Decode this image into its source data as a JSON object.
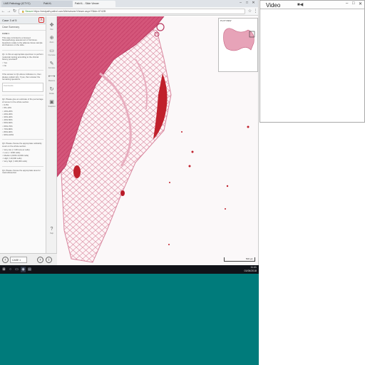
{
  "browser": {
    "tabs": [
      {
        "label": "LMS Pathology (ICTYC)"
      },
      {
        "label": "PathXL"
      },
      {
        "label": "PathXL - Slide Viewer"
      }
    ],
    "window_controls": {
      "minimize": "–",
      "maximize": "□",
      "close": "✕"
    },
    "address": {
      "secure_label": "Secure",
      "url": "https://restpath.pathxl.com/Webviewer/Viewer.aspx?Slide=5742B"
    }
  },
  "question_panel": {
    "title": "Case 3 of 5",
    "close_label": "X",
    "subtitle": "Case Summary",
    "case_label": "CASE 1",
    "intro": "This case is limited to a focused histopathology assessment of fat tissue. Questions relate to the adipose tissue sample and features on the slide.",
    "q1": "Q1. Is this an appropriate specimen to perform molecular testing according to the clinical history provided?",
    "q1_options": [
      "Yes",
      "No"
    ],
    "note": "If the answer to Q1 above indicates no, then please explain why. If yes, then answer the remaining questions.",
    "q1_box_placeholder": "Comments",
    "q2": "Q2. Please give an estimate of the percentage of tumour in the whole section.",
    "q2_options": [
      "0-5%",
      "5%-10%",
      "10%-20%",
      "20%-30%",
      "30%-40%",
      "40%-50%",
      "50%-60%",
      "60%-70%",
      "70%-80%",
      "80%-90%",
      "90%-100%"
    ],
    "q3": "Q3. Please choose the appropriate cellularity count on the whole section.",
    "q3_options": [
      "Very low (< 100 tumour cells)",
      "Low (< 1000 cells)",
      "Medium (1000-10,000 cells)",
      "High (>10,000 cells)",
      "Very high (>100,000 cells)"
    ],
    "q4": "Q4. Please choose the appropriate area for macrodissection"
  },
  "toolbar": {
    "tools": [
      {
        "icon": "pan-icon",
        "glyph": "✥",
        "label": "Pan"
      },
      {
        "icon": "zoom-icon",
        "glyph": "⊕",
        "label": "Zoom"
      },
      {
        "icon": "overview-icon",
        "glyph": "▭",
        "label": "Overview"
      },
      {
        "icon": "annotate-icon",
        "glyph": "✎",
        "label": "Annotate"
      },
      {
        "icon": "measure-icon",
        "glyph": "⟷",
        "label": "Measure"
      },
      {
        "icon": "rotate-icon",
        "glyph": "↻",
        "label": "Rotate"
      },
      {
        "icon": "snapshot-icon",
        "glyph": "▣",
        "label": "Snapshot"
      },
      {
        "icon": "help-icon",
        "glyph": "?",
        "label": "Help"
      }
    ]
  },
  "viewer": {
    "overview_title": "PLOTVIEW",
    "scale_label": "500 µm"
  },
  "bottom_bar": {
    "case_label": "CASE 1",
    "prev": "‹",
    "next": "›",
    "info": "i"
  },
  "taskbar": {
    "start": "⊞",
    "time": "11:41",
    "date": "01/06/2018"
  },
  "video_panel": {
    "title": "Video",
    "camera_icon": "camera-icon",
    "controls": [
      "–",
      "□",
      "✕"
    ]
  },
  "colors": {
    "tissue_pink": "#d46a85",
    "stroma_pink": "#e8aebf",
    "vessel_red": "#c0202c",
    "taskbar": "#101218",
    "desktop_teal": "#007b7b"
  }
}
